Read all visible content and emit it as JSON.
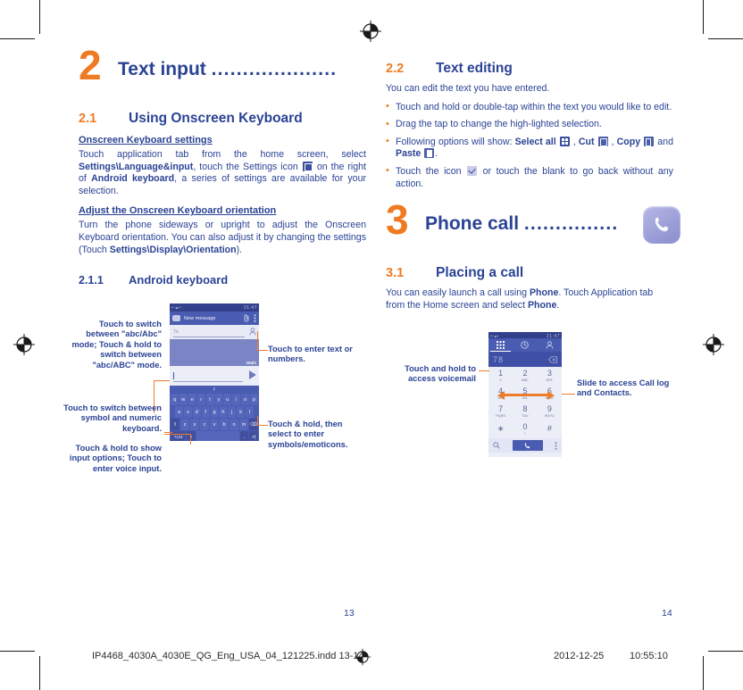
{
  "meta": {
    "page_left_number": "13",
    "page_right_number": "14",
    "accent_orange": "#f07a22",
    "accent_blue": "#2b4394"
  },
  "chapter2": {
    "number": "2",
    "title": "Text input ",
    "dots": "....................",
    "section": {
      "num": "2.1",
      "title": "Using Onscreen Keyboard"
    },
    "settings_head": "Onscreen Keyboard settings",
    "settings_p1_a": "Touch application tab from the home screen, select ",
    "settings_p1_b": "Settings\\Language&input",
    "settings_p1_c": ", touch the Settings icon ",
    "settings_p1_d": " on the right of ",
    "settings_p1_e": "Android keyboard",
    "settings_p1_f": ", a series of settings are available for your selection.",
    "orient_head": "Adjust the Onscreen Keyboard orientation",
    "orient_p_a": "Turn the phone sideways or upright to adjust the Onscreen Keyboard orientation. You can also adjust it by changing the settings (Touch ",
    "orient_p_b": "Settings\\Display\\Orientation",
    "orient_p_c": ").",
    "subsection": {
      "num": "2.1.1",
      "title": "Android keyboard"
    },
    "callouts": {
      "abc_mode": "Touch to switch between \"abc/Abc\" mode; Touch & hold to switch between \"abc/ABC\" mode.",
      "symbol_numeric": "Touch to switch between symbol and numeric keyboard.",
      "input_options": "Touch & hold to show input options; Touch to enter voice input.",
      "enter_text": "Touch to enter text or numbers.",
      "symbols_emoticons": "Touch & hold, then select to enter symbols/emoticons."
    }
  },
  "keyboard_shot": {
    "status_left": "icons",
    "status_right": "21:47",
    "title": "New message",
    "to_label": "To",
    "char_count": "104/1",
    "suggest": "f",
    "typed": "d",
    "rows": [
      [
        "q",
        "w",
        "e",
        "r",
        "t",
        "y",
        "u",
        "i",
        "o",
        "p"
      ],
      [
        "a",
        "s",
        "d",
        "f",
        "g",
        "h",
        "j",
        "k",
        "l"
      ],
      [
        "shift",
        "z",
        "x",
        "c",
        "v",
        "b",
        "n",
        "m",
        "del"
      ],
      [
        "?123",
        "mic",
        "space",
        ".",
        "enter"
      ]
    ],
    "shift_label": "⇧",
    "symbol_label": "?123",
    "delete_label": "⌫",
    "enter_label": ">|",
    "period_label": ".",
    "mic_label": "•"
  },
  "chapter2_2": {
    "num": "2.2",
    "title": "Text editing",
    "intro": "You can edit the text you have entered.",
    "bullets": [
      {
        "text": "Touch and hold or double-tap within the text you would like to edit."
      },
      {
        "text": "Drag the tap to change the high-lighted selection."
      },
      {
        "prefix": "Following options will show: ",
        "b1": "Select all",
        "sep1": " , ",
        "b2": "Cut",
        "sep2": " , ",
        "b3": "Copy",
        "sep3": " and ",
        "b4": "Paste",
        "suffix": "."
      },
      {
        "prefix": "Touch the icon ",
        "suffix": " or touch the blank to go back without any action."
      }
    ]
  },
  "chapter3": {
    "number": "3",
    "title": "Phone call ",
    "dots": "...............",
    "section": {
      "num": "3.1",
      "title": "Placing a call"
    },
    "intro_a": "You can easily launch a call using ",
    "intro_b": "Phone",
    "intro_c": ". Touch Application tab from the Home screen and select ",
    "intro_d": "Phone",
    "intro_e": ".",
    "callouts": {
      "voicemail": "Touch and hold to access voicemail",
      "slide_a": "Slide to access ",
      "slide_b": "Call log",
      "slide_c": " and ",
      "slide_d": "Contacts",
      "slide_e": "."
    }
  },
  "dial_shot": {
    "status_right": "21:47",
    "entry": "78",
    "keys": [
      [
        {
          "d": "1",
          "s": "∞"
        },
        {
          "d": "2",
          "s": "ABC"
        },
        {
          "d": "3",
          "s": "DEF"
        }
      ],
      [
        {
          "d": "4",
          "s": "GHI"
        },
        {
          "d": "5",
          "s": "JKL"
        },
        {
          "d": "6",
          "s": "MNO"
        }
      ],
      [
        {
          "d": "7",
          "s": "PQRS"
        },
        {
          "d": "8",
          "s": "TUV"
        },
        {
          "d": "9",
          "s": "WXYZ"
        }
      ],
      [
        {
          "d": "∗",
          "s": ""
        },
        {
          "d": "0",
          "s": "+"
        },
        {
          "d": "#",
          "s": ""
        }
      ]
    ]
  },
  "footer": {
    "filename": "IP4468_4030A_4030E_QG_Eng_USA_04_121225.indd   13-14",
    "date": "2012-12-25",
    "time": "10:55:10"
  }
}
